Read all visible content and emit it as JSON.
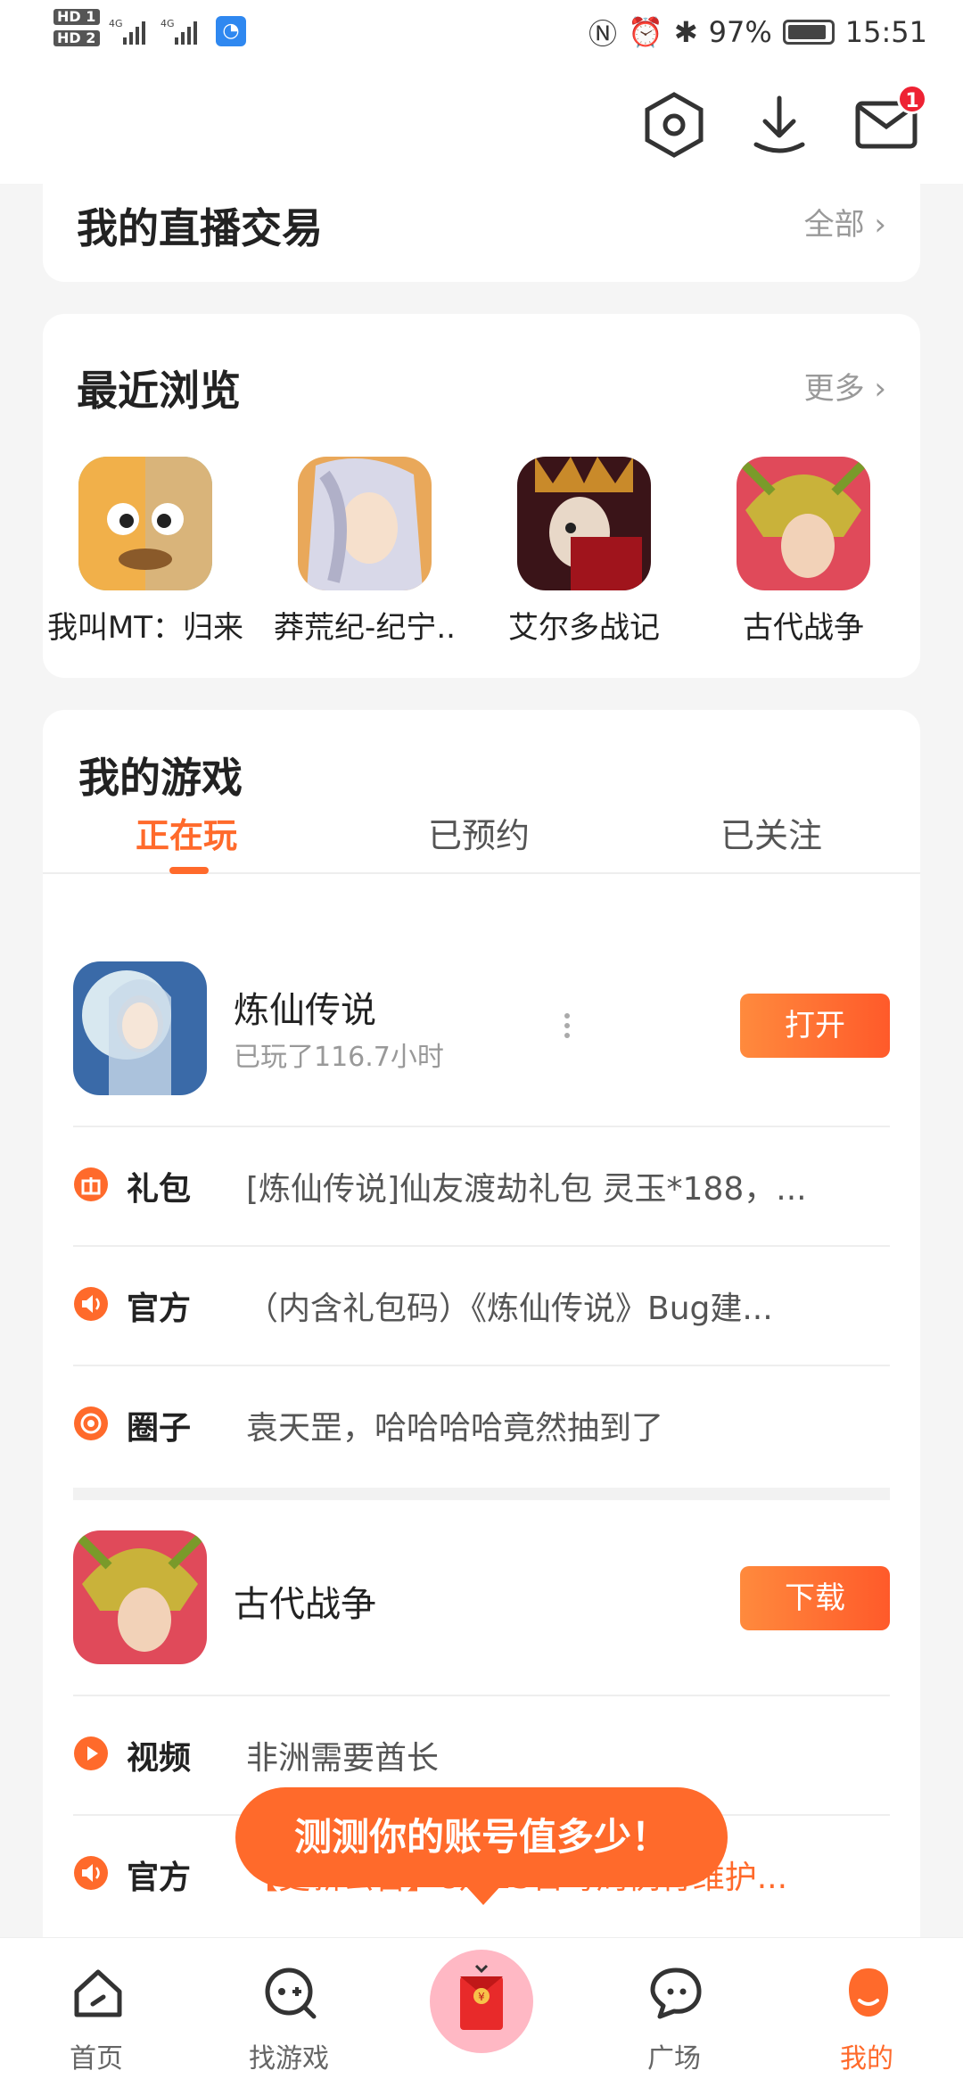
{
  "status_bar": {
    "hd1": "HD 1",
    "hd2": "HD 2",
    "battery": "97%",
    "time": "15:51"
  },
  "header": {
    "mail_badge": "1"
  },
  "live_trade": {
    "title": "我的直播交易",
    "more": "全部 ›"
  },
  "recent": {
    "title": "最近浏览",
    "more": "更多 ›",
    "items": [
      {
        "name": "我叫MT：归来"
      },
      {
        "name": "莽荒纪-纪宁.."
      },
      {
        "name": "艾尔多战记"
      },
      {
        "name": "古代战争"
      }
    ]
  },
  "my_games": {
    "title": "我的游戏",
    "tabs": [
      "正在玩",
      "已预约",
      "已关注"
    ],
    "games": [
      {
        "name": "炼仙传说",
        "sub": "已玩了116.7小时",
        "button": "打开",
        "rows": [
          {
            "label": "礼包",
            "text": "[炼仙传说]仙友渡劫礼包 灵玉*188，..."
          },
          {
            "label": "官方",
            "text": "（内含礼包码）《炼仙传说》Bug建..."
          },
          {
            "label": "圈子",
            "text": "袁天罡，哈哈哈哈竟然抽到了"
          }
        ]
      },
      {
        "name": "古代战争",
        "button": "下载",
        "rows": [
          {
            "label": "视频",
            "text": "非洲需要酋长"
          },
          {
            "label": "官方",
            "text": "【更新公告】8月23日每周例行维护..."
          }
        ]
      }
    ]
  },
  "promo": {
    "text": "测测你的账号值多少！"
  },
  "bottom_nav": [
    {
      "label": "首页"
    },
    {
      "label": "找游戏"
    },
    {
      "label": ""
    },
    {
      "label": "广场"
    },
    {
      "label": "我的"
    }
  ],
  "colors": {
    "accent": "#ff6a2b",
    "badge": "#ee2233"
  }
}
